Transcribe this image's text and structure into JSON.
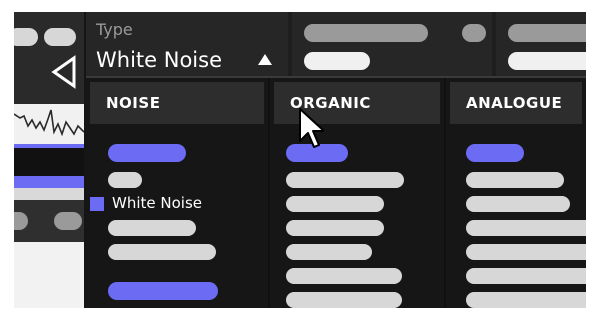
{
  "type_selector": {
    "label": "Type",
    "value": "White Noise"
  },
  "dropdown": {
    "columns": [
      {
        "header": "NOISE",
        "selected_item": "White Noise"
      },
      {
        "header": "ORGANIC"
      },
      {
        "header": "ANALOGUE"
      }
    ]
  },
  "colors": {
    "accent": "#6b6bf4",
    "placeholder": "#d7d7d7",
    "panel": "#262626",
    "background": "#151515"
  },
  "icons": [
    "triangle-up-icon",
    "play-back-icon",
    "mouse-pointer-icon"
  ]
}
